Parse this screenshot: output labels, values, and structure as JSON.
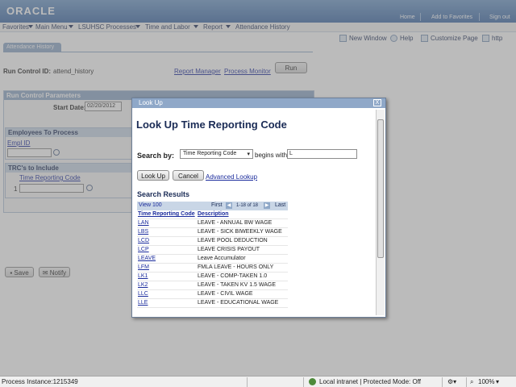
{
  "header": {
    "logo": "ORACLE",
    "links": [
      "Home",
      "Add to Favorites",
      "Sign out"
    ]
  },
  "nav": {
    "items": [
      "Favorites",
      "Main Menu",
      "LSUHSC Processes",
      "Time and Labor",
      "Report"
    ],
    "current": "Attendance History"
  },
  "toolbar": {
    "new_window": "New Window",
    "help": "Help",
    "customize": "Customize Page",
    "http": "http"
  },
  "page": {
    "tab": "Attendance History",
    "run_control_label": "Run Control ID:",
    "run_control_value": "attend_history",
    "report_manager": "Report Manager",
    "process_monitor": "Process Monitor",
    "run_button": "Run",
    "params_header": "Run Control Parameters",
    "start_date_label": "Start Date:",
    "start_date_value": "02/20/2012",
    "employees_header": "Employees To Process",
    "empl_id_label": "Empl ID",
    "trc_header": "TRC's to Include",
    "trc_col": "Time Reporting Code",
    "trc_row_num": "1",
    "save_button": "Save",
    "notify_button": "Notify"
  },
  "modal": {
    "title": "Look Up",
    "close": "X",
    "heading": "Look Up Time Reporting Code",
    "search_by_label": "Search by:",
    "search_by_value": "Time Reporting Code",
    "operator": "begins with",
    "search_value": "L",
    "lookup_button": "Look Up",
    "cancel_button": "Cancel",
    "advanced_link": "Advanced Lookup",
    "results_title": "Search Results",
    "view_link": "View 100",
    "first": "First",
    "range": "1-18 of 18",
    "last": "Last",
    "columns": [
      "Time Reporting Code",
      "Description"
    ],
    "rows": [
      {
        "code": "LAN",
        "desc": "LEAVE - ANNUAL BW WAGE"
      },
      {
        "code": "LBS",
        "desc": "LEAVE - SICK BIWEEKLY WAGE"
      },
      {
        "code": "LCD",
        "desc": "LEAVE POOL DEDUCTION"
      },
      {
        "code": "LCP",
        "desc": "LEAVE CRISIS PAYOUT"
      },
      {
        "code": "LEAVE",
        "desc": "Leave Accumulator"
      },
      {
        "code": "LFM",
        "desc": "FMLA LEAVE - HOURS ONLY"
      },
      {
        "code": "LK1",
        "desc": "LEAVE -  COMP-TAKEN 1.0"
      },
      {
        "code": "LK2",
        "desc": "LEAVE - TAKEN KV 1.5 WAGE"
      },
      {
        "code": "LLC",
        "desc": "LEAVE - CIVIL WAGE"
      },
      {
        "code": "LLE",
        "desc": "LEAVE - EDUCATIONAL WAGE"
      }
    ]
  },
  "status": {
    "process": "Process Instance:1215349",
    "zone": "Local intranet | Protected Mode: Off",
    "zoom": "100%"
  },
  "colors": {
    "header": "#3e6aa6",
    "accent": "#8fa8c8",
    "link": "#1a2b9c"
  }
}
